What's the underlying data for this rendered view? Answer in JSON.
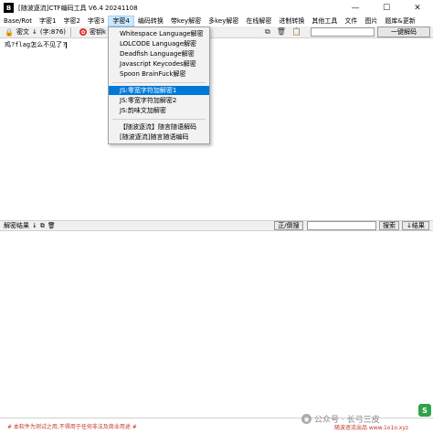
{
  "window": {
    "app_icon": "B",
    "title": "[随波逐流]CTF编码工具 V6.4 20241108",
    "controls": [
      "—",
      "☐",
      "✕"
    ]
  },
  "menu": {
    "items": [
      "Base/Rot",
      "字密1",
      "字密2",
      "字密3",
      "字密4",
      "编码转换",
      "带key解密",
      "多key解密",
      "在线解密",
      "进制转换",
      "其他工具",
      "文件",
      "图片",
      "题库&更新"
    ],
    "active_index": 4
  },
  "toolbar": {
    "cipher_label": "密文",
    "cipher_icon": "lock-icon",
    "char_count": "(字:876)",
    "plain_label": "密钥k",
    "decode_all_label": "一键解码"
  },
  "input": {
    "text": "鸡?flag怎么不见了?"
  },
  "dropdown": {
    "items": [
      "Whitespace Language解密",
      "LOLCODE Language解密",
      "Deadfish Language解密",
      "Javascript Keycodes解密",
      "Spoon BrainFuck解密",
      "JS:零宽字符加解密1",
      "JS:零宽字符加解密2",
      "JS:韵味文加解密",
      "【随波逐流】随言随语解码",
      "[随波逐流]随言随语编码"
    ],
    "selected_index": 5
  },
  "result_bar": {
    "label": "解密结果",
    "reverse_button": "正/倒搜",
    "search_button": "搜索",
    "result_button": "↓结果"
  },
  "footer": {
    "left_note": "# 本软件为测试之用,不得用于任何非法及商业用途 #",
    "watermark": "公众号 · 长弓三皮",
    "right_note": "随波逐流出品  www.1o1o.xyz"
  }
}
